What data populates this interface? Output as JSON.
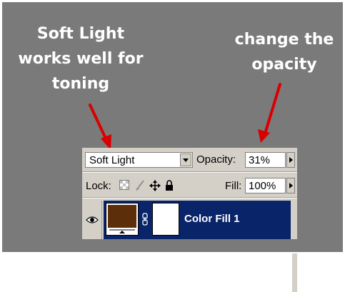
{
  "annotations": {
    "left_callout": [
      "Soft Light",
      "works well for",
      "toning"
    ],
    "right_callout": [
      "change the",
      "opacity"
    ]
  },
  "layers_panel": {
    "blend_mode": "Soft Light",
    "opacity_label": "Opacity:",
    "opacity_value": "31%",
    "lock_label": "Lock:",
    "fill_label": "Fill:",
    "fill_value": "100%",
    "layer": {
      "name": "Color Fill 1",
      "fill_color": "#5c2f0a",
      "selected_color": "#0a246a"
    }
  },
  "icons": [
    "eye-icon",
    "lock-transparency-icon",
    "lock-paint-icon",
    "lock-move-icon",
    "lock-all-icon",
    "link-icon",
    "dropdown-arrow-icon",
    "slider-arrow-icon"
  ],
  "colors": {
    "background": "#7a7a7a",
    "arrow": "#d90000",
    "panel": "#d4d0c8"
  }
}
